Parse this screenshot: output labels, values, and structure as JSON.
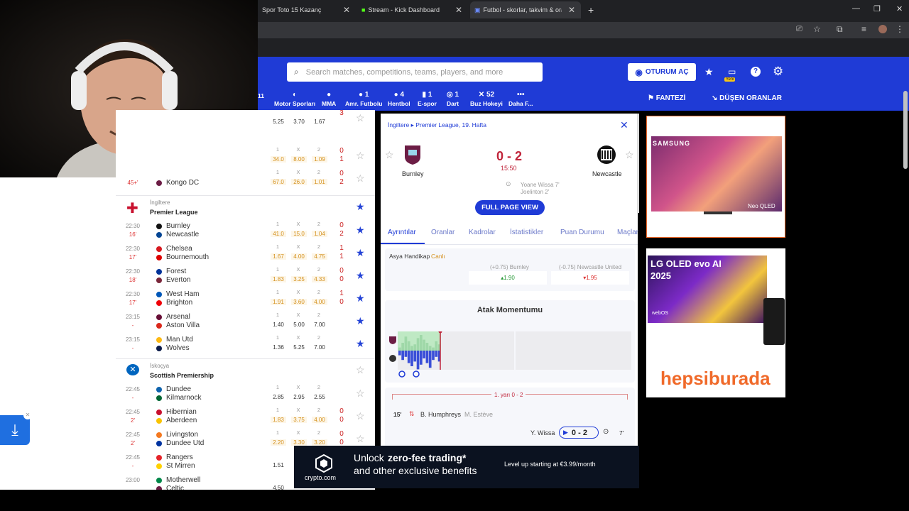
{
  "browser": {
    "tabs": [
      {
        "label": "Spor Toto 15 Kazanç",
        "active": false
      },
      {
        "label": "Stream - Kick Dashboard",
        "active": false
      },
      {
        "label": "Futbol - skorlar, takvim & oranl",
        "active": true
      }
    ],
    "new_tab": "+",
    "win_min": "—",
    "win_max": "❐",
    "win_close": "✕"
  },
  "site": {
    "search_placeholder": "Search matches, competitions, teams, players, and more",
    "login": "OTURUM AÇ",
    "new_badge": "Yeni",
    "sports": [
      {
        "label": "Motor Sporları",
        "count": ""
      },
      {
        "label": "MMA",
        "count": ""
      },
      {
        "label": "Amr. Futbolu",
        "count": "1"
      },
      {
        "label": "Hentbol",
        "count": "4"
      },
      {
        "label": "E-spor",
        "count": "1"
      },
      {
        "label": "Dart",
        "count": "1"
      },
      {
        "label": "Buz Hokeyi",
        "count": "52"
      },
      {
        "label": "Daha F...",
        "count": ""
      }
    ],
    "sports_partial_count": "11",
    "fantezi": "FANTEZİ",
    "dusen": "DÜŞEN ORANLAR"
  },
  "left_list": {
    "rows_top": [
      {
        "odds": [
          "5.25",
          "3.70",
          "1.67"
        ],
        "score": [
          "3",
          ""
        ],
        "labels": false,
        "live": false
      },
      {
        "odds": [
          "34.0",
          "8.00",
          "1.09"
        ],
        "score": [
          "0",
          "1"
        ],
        "labels": true,
        "live": true
      },
      {
        "odds": [
          "67.0",
          "26.0",
          "1.01"
        ],
        "score": [
          "0",
          "2"
        ],
        "labels": true,
        "live": true,
        "min": "45+'",
        "t2": "Kongo DC"
      }
    ],
    "league1": {
      "country": "İngiltere",
      "name": "Premier League"
    },
    "pl_rows": [
      {
        "time": "22:30",
        "min": "16'",
        "t1": "Burnley",
        "t2": "Newcastle",
        "odds": [
          "41.0",
          "15.0",
          "1.04"
        ],
        "score": [
          "0",
          "2"
        ],
        "live": true
      },
      {
        "time": "22:30",
        "min": "17'",
        "t1": "Chelsea",
        "t2": "Bournemouth",
        "odds": [
          "1.67",
          "4.00",
          "4.75"
        ],
        "score": [
          "1",
          "1"
        ],
        "live": true
      },
      {
        "time": "22:30",
        "min": "18'",
        "t1": "Forest",
        "t2": "Everton",
        "odds": [
          "1.83",
          "3.25",
          "4.33"
        ],
        "score": [
          "0",
          "0"
        ],
        "live": true
      },
      {
        "time": "22:30",
        "min": "17'",
        "t1": "West Ham",
        "t2": "Brighton",
        "odds": [
          "1.91",
          "3.60",
          "4.00"
        ],
        "score": [
          "1",
          "0"
        ],
        "live": true
      },
      {
        "time": "23:15",
        "min": "-",
        "t1": "Arsenal",
        "t2": "Aston Villa",
        "odds": [
          "1.40",
          "5.00",
          "7.00"
        ],
        "score": [
          "",
          ""
        ],
        "live": false
      },
      {
        "time": "23:15",
        "min": "-",
        "t1": "Man Utd",
        "t2": "Wolves",
        "odds": [
          "1.36",
          "5.25",
          "7.00"
        ],
        "score": [
          "",
          ""
        ],
        "live": false
      }
    ],
    "league2": {
      "country": "İskoçya",
      "name": "Scottish Premiership"
    },
    "sc_rows": [
      {
        "time": "22:45",
        "min": "-",
        "t1": "Dundee",
        "t2": "Kilmarnock",
        "odds": [
          "2.85",
          "2.95",
          "2.55"
        ],
        "score": [
          "",
          ""
        ],
        "live": false
      },
      {
        "time": "22:45",
        "min": "2'",
        "t1": "Hibernian",
        "t2": "Aberdeen",
        "odds": [
          "1.83",
          "3.75",
          "4.00"
        ],
        "score": [
          "0",
          "0"
        ],
        "live": true
      },
      {
        "time": "22:45",
        "min": "2'",
        "t1": "Livingston",
        "t2": "Dundee Utd",
        "odds": [
          "2.20",
          "3.30",
          "3.20"
        ],
        "score": [
          "0",
          "0"
        ],
        "live": true
      },
      {
        "time": "22:45",
        "min": "-",
        "t1": "Rangers",
        "t2": "St Mirren",
        "odds": [
          "1.51",
          "",
          ""
        ],
        "score": [
          "",
          ""
        ],
        "live": false
      },
      {
        "time": "23:00",
        "min": "",
        "t1": "Motherwell",
        "t2": "Celtic",
        "odds": [
          "4.50",
          "",
          ""
        ],
        "score": [
          "",
          ""
        ],
        "live": false
      }
    ],
    "odds_labels": [
      "1",
      "X",
      "2"
    ]
  },
  "detail": {
    "breadcrumb_country": "İngiltere",
    "breadcrumb_arrow": "▸",
    "breadcrumb_league": "Premier League, 19. Hafta",
    "home": "Burnley",
    "away": "Newcastle",
    "score": "0 - 2",
    "clock": "15:50",
    "scorers": [
      "Yoane Wissa 7'",
      "Joelinton 2'"
    ],
    "full_page": "FULL PAGE VIEW",
    "tabs": [
      "Ayrıntılar",
      "Oranlar",
      "Kadrolar",
      "İstatistikler",
      "Puan Durumu",
      "Maçlar"
    ],
    "handicap_title": "Asya Handikap",
    "handicap_live": "Canlı",
    "h_home_label": "(+0.75) Burnley",
    "h_home_val": "1.90",
    "h_away_label": "(-0.75) Newcastle United",
    "h_away_val": "1.95",
    "momentum_title": "Atak Momentumu",
    "half_label": "1. yarı 0 - 2",
    "event_min": "15'",
    "event_in": "B. Humphreys",
    "event_out": "M. Estève",
    "goal_player": "Y. Wissa",
    "goal_score": "0 - 2",
    "goal_min": "7'",
    "momentum_home": [
      2,
      5,
      9,
      6,
      3,
      4,
      8,
      10,
      7,
      5,
      3,
      2,
      6,
      4
    ],
    "momentum_away": [
      3,
      6,
      4,
      8,
      10,
      7,
      12,
      9,
      5,
      8,
      11,
      6,
      4,
      7
    ]
  },
  "ads": {
    "samsung": "SAMSUNG",
    "neo": "Neo QLED",
    "lg": "LG OLED evo AI",
    "lg_year": "2025",
    "webos": "webOS",
    "hepsiburada": "hepsiburada",
    "crypto_brand": "crypto.com",
    "crypto_line1_a": "Unlock ",
    "crypto_line1_b": "zero-fee trading*",
    "crypto_line2": "and other exclusive benefits",
    "crypto_level": "Level up starting at €3.99/month"
  },
  "colors": {
    "brand": "#1f3bd6",
    "live": "#d4901c",
    "score_red": "#c22"
  }
}
